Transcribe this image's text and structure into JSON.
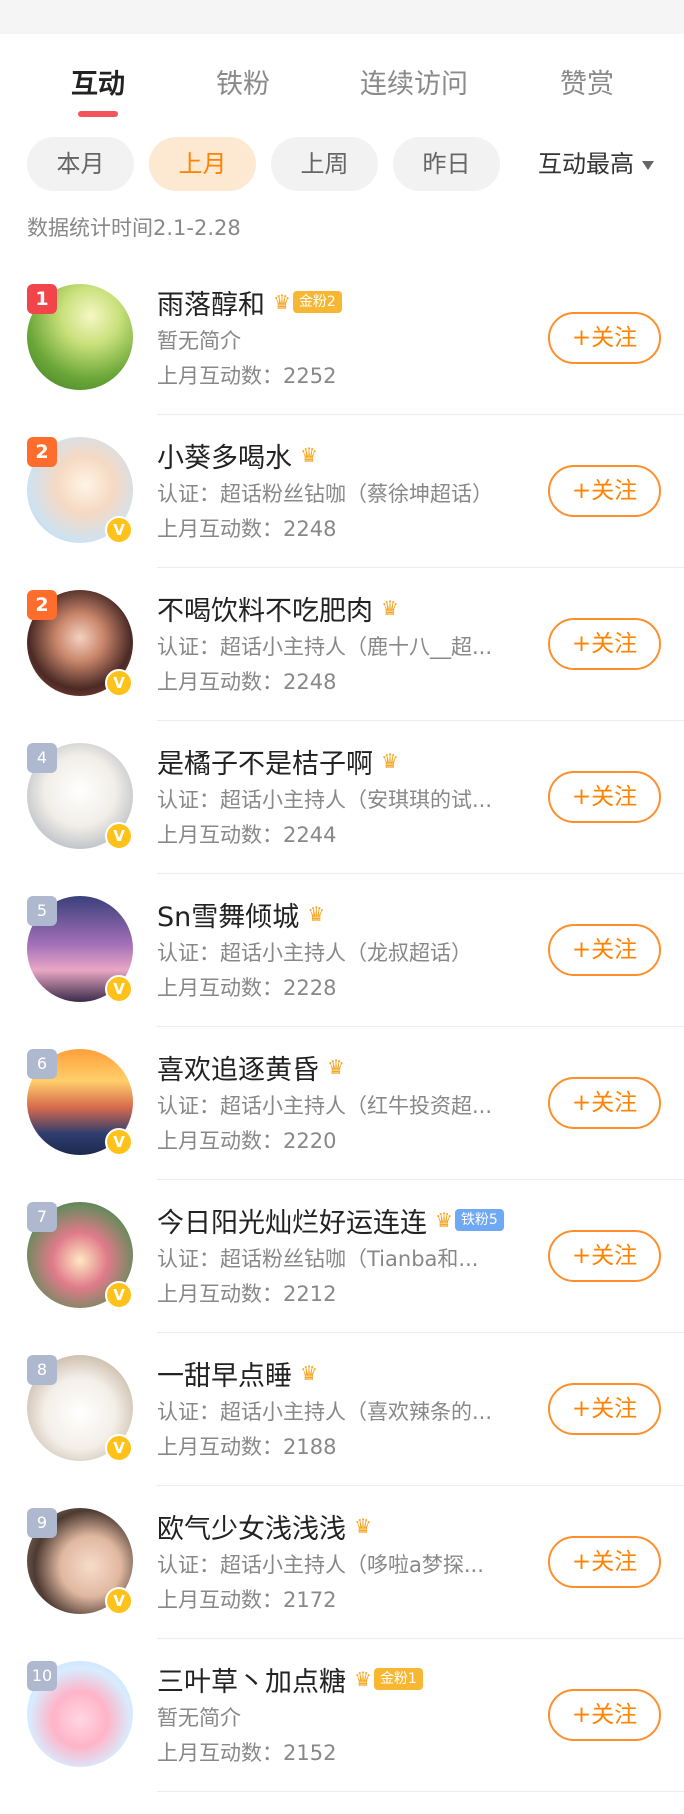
{
  "tabs": [
    {
      "label": "互动",
      "active": true
    },
    {
      "label": "铁粉",
      "active": false
    },
    {
      "label": "连续访问",
      "active": false
    },
    {
      "label": "赞赏",
      "active": false
    }
  ],
  "filters": {
    "pills": [
      {
        "label": "本月",
        "active": false
      },
      {
        "label": "上月",
        "active": true
      },
      {
        "label": "上周",
        "active": false
      },
      {
        "label": "昨日",
        "active": false
      }
    ],
    "sort_label": "互动最高"
  },
  "stat_time": "数据统计时间2.1-2.28",
  "follow_label": "+关注",
  "verified_glyph": "V",
  "rows": [
    {
      "rank": "1",
      "name": "雨落醇和",
      "tag": "金粉2",
      "tag_type": "gold",
      "desc": "暂无简介",
      "count": "上月互动数：2252",
      "verified": false
    },
    {
      "rank": "2",
      "name": "小葵多喝水",
      "tag": "",
      "tag_type": "",
      "desc": "认证：超话粉丝钻咖（蔡徐坤超话）",
      "count": "上月互动数：2248",
      "verified": true
    },
    {
      "rank": "2",
      "name": "不喝饮料不吃肥肉",
      "tag": "",
      "tag_type": "",
      "desc": "认证：超话小主持人（鹿十八__超...",
      "count": "上月互动数：2248",
      "verified": true
    },
    {
      "rank": "4",
      "name": "是橘子不是桔子啊",
      "tag": "",
      "tag_type": "",
      "desc": "认证：超话小主持人（安琪琪的试...",
      "count": "上月互动数：2244",
      "verified": true
    },
    {
      "rank": "5",
      "name": "Sn雪舞倾城",
      "tag": "",
      "tag_type": "",
      "desc": "认证：超话小主持人（龙叔超话）",
      "count": "上月互动数：2228",
      "verified": true
    },
    {
      "rank": "6",
      "name": "喜欢追逐黄昏",
      "tag": "",
      "tag_type": "",
      "desc": "认证：超话小主持人（红牛投资超...",
      "count": "上月互动数：2220",
      "verified": true
    },
    {
      "rank": "7",
      "name": "今日阳光灿烂好运连连",
      "tag": "铁粉5",
      "tag_type": "blue",
      "desc": "认证：超话粉丝钻咖（Tianba和...",
      "count": "上月互动数：2212",
      "verified": true
    },
    {
      "rank": "8",
      "name": "一甜早点睡",
      "tag": "",
      "tag_type": "",
      "desc": "认证：超话小主持人（喜欢辣条的...",
      "count": "上月互动数：2188",
      "verified": true
    },
    {
      "rank": "9",
      "name": "欧气少女浅浅浅",
      "tag": "",
      "tag_type": "",
      "desc": "认证：超话小主持人（哆啦a梦探...",
      "count": "上月互动数：2172",
      "verified": true
    },
    {
      "rank": "10",
      "name": "三叶草丶加点糖",
      "tag": "金粉1",
      "tag_type": "gold",
      "desc": "暂无简介",
      "count": "上月互动数：2152",
      "verified": false
    }
  ]
}
